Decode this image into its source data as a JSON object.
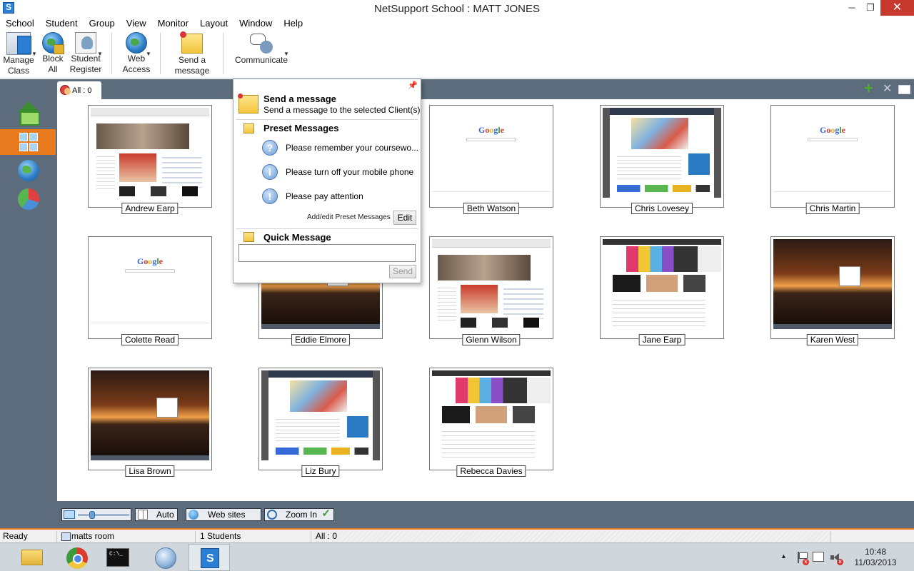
{
  "window": {
    "title": "NetSupport School : MATT JONES",
    "minimize": "─",
    "maximize": "❐",
    "close": "✕"
  },
  "menu": [
    "School",
    "Student",
    "Group",
    "View",
    "Monitor",
    "Layout",
    "Window",
    "Help"
  ],
  "toolbar": {
    "manage_class": [
      "Manage",
      "Class"
    ],
    "block_all": [
      "Block",
      "All"
    ],
    "student_register": [
      "Student",
      "Register"
    ],
    "web_access": [
      "Web",
      "Access"
    ],
    "send_message": [
      "Send a",
      "message"
    ],
    "communicate": "Communicate",
    "dropdown_arrow": "▼",
    "icons": {
      "manage_class": "manage-class-icon",
      "block_all": "globe-lock-icon",
      "student_register": "student-register-icon",
      "web_access": "globe-icon",
      "send_message": "sticky-note-icon",
      "communicate": "chat-bubble-icon"
    }
  },
  "group_tab": {
    "label": "All : 0"
  },
  "right_icons": {
    "add": "+",
    "remove": "✕"
  },
  "students": [
    {
      "name": "Andrew Earp",
      "screen": "youtube"
    },
    {
      "name": "Beth Watson",
      "screen": "google"
    },
    {
      "name": "Chris Lovesey",
      "screen": "promo"
    },
    {
      "name": "Chris Martin",
      "screen": "google"
    },
    {
      "name": "Colette Read",
      "screen": "google"
    },
    {
      "name": "Eddie Elmore",
      "screen": "sunset"
    },
    {
      "name": "Glenn Wilson",
      "screen": "youtube"
    },
    {
      "name": "Jane Earp",
      "screen": "bbc"
    },
    {
      "name": "Karen West",
      "screen": "sunset"
    },
    {
      "name": "Lisa Brown",
      "screen": "sunset"
    },
    {
      "name": "Liz Bury",
      "screen": "promo"
    },
    {
      "name": "Rebecca Davies",
      "screen": "bbc"
    }
  ],
  "google_logo": [
    "G",
    "o",
    "o",
    "g",
    "l",
    "e"
  ],
  "popup": {
    "pin": "📌",
    "title": "Send a message",
    "subtitle": "Send a message to the selected Client(s)",
    "preset_heading": "Preset Messages",
    "presets": [
      {
        "icon": "?",
        "text": "Please remember your coursewo..."
      },
      {
        "icon": "i",
        "text": "Please turn off your mobile phone"
      },
      {
        "icon": "!",
        "text": "Please pay attention"
      }
    ],
    "add_edit_label": "Add/edit Preset Messages",
    "edit_button": "Edit",
    "quick_heading": "Quick Message",
    "quick_value": "",
    "send_button": "Send"
  },
  "bottom_strip": {
    "auto": "Auto",
    "web_sites": "Web sites",
    "zoom_in": "Zoom In",
    "check": "✓"
  },
  "statusbar": {
    "ready": "Ready",
    "room": "matts room",
    "students": "1 Students",
    "all": "All : 0"
  },
  "taskbar": {
    "cmd_glyph": "C:\\_",
    "tray_up": "▲",
    "time": "10:48",
    "date": "11/03/2013"
  }
}
